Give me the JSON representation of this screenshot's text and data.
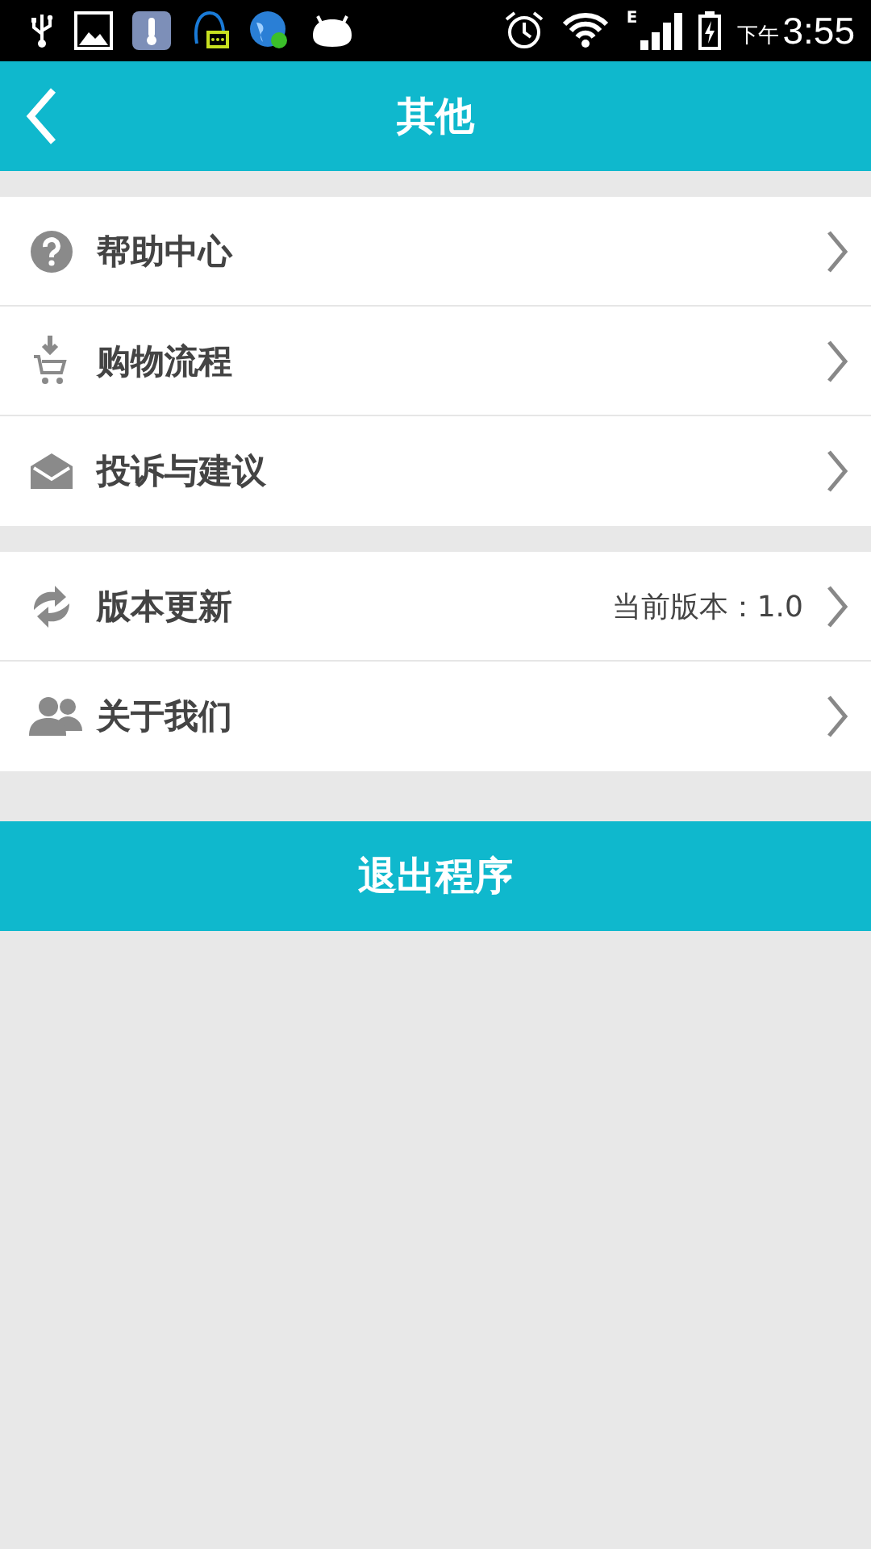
{
  "status_bar": {
    "network": "E",
    "period": "下午",
    "time": "3:55"
  },
  "header": {
    "title": "其他"
  },
  "groups": [
    {
      "items": [
        {
          "kind": "help",
          "label": "帮助中心"
        },
        {
          "kind": "cart",
          "label": "购物流程"
        },
        {
          "kind": "mail",
          "label": "投诉与建议"
        }
      ]
    },
    {
      "items": [
        {
          "kind": "update",
          "label": "版本更新",
          "value": "当前版本：1.0"
        },
        {
          "kind": "people",
          "label": "关于我们"
        }
      ]
    }
  ],
  "exit_button": "退出程序"
}
